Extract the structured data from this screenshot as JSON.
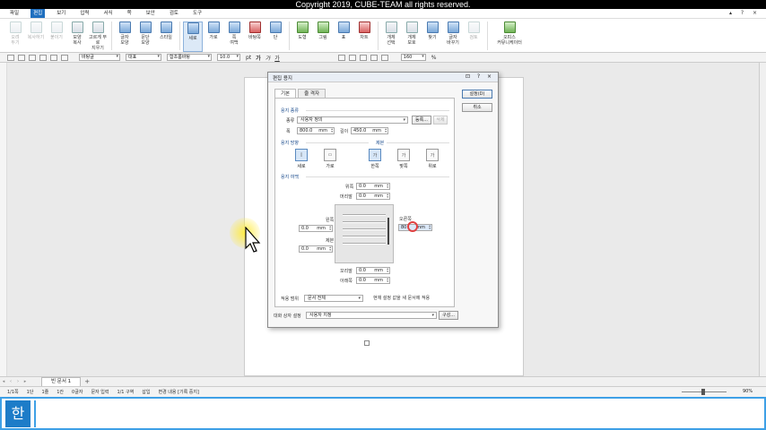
{
  "banner": {
    "text": "Copyright 2019, CUBE-TEAM all rights reserved."
  },
  "menubar": {
    "items": [
      "파일",
      "편집",
      "보기",
      "입력",
      "서식",
      "쪽",
      "보안",
      "검토",
      "도구"
    ],
    "active_index": 1
  },
  "ribbon": {
    "buttons": [
      {
        "label": "오려\n두기",
        "icon": "cut-icon",
        "dim": true
      },
      {
        "label": "복사하기",
        "icon": "copy-icon",
        "dim": true
      },
      {
        "label": "붙이기",
        "icon": "paste-icon",
        "dim": true
      },
      {
        "label": "모양\n복사",
        "icon": "format-painter-icon"
      },
      {
        "label": "고르게 부로\n지우기",
        "icon": "eraser-icon"
      },
      {
        "label": "글자\n모양",
        "icon": "char-shape-icon"
      },
      {
        "label": "문단\n모양",
        "icon": "para-shape-icon"
      },
      {
        "label": "스타일",
        "icon": "style-icon"
      },
      {
        "label": "세로",
        "icon": "portrait-icon",
        "selected": true
      },
      {
        "label": "가로",
        "icon": "landscape-icon"
      },
      {
        "label": "쪽\n여백",
        "icon": "margin-icon"
      },
      {
        "label": "바탕쪽",
        "icon": "master-page-icon"
      },
      {
        "label": "단",
        "icon": "columns-icon"
      },
      {
        "label": "도형",
        "icon": "shape-icon"
      },
      {
        "label": "그림",
        "icon": "picture-icon"
      },
      {
        "label": "표",
        "icon": "table-icon"
      },
      {
        "label": "차트",
        "icon": "chart-icon"
      },
      {
        "label": "개체\n선택",
        "icon": "select-object-icon"
      },
      {
        "label": "개체\n보호",
        "icon": "protect-object-icon"
      },
      {
        "label": "찾기",
        "icon": "find-icon"
      },
      {
        "label": "글자\n바꾸기",
        "icon": "replace-icon"
      },
      {
        "label": "검토",
        "icon": "review-icon",
        "dim": true
      },
      {
        "label": "오피스\n커뮤니케이터",
        "icon": "communicator-icon",
        "wide": true
      }
    ]
  },
  "formatbar": {
    "style_value": "바탕글",
    "lang_value": "대표",
    "font_value": "함초롬바탕",
    "size_value": "10.0",
    "size_unit": "pt",
    "bold": "가",
    "italic": "가",
    "underline": "가",
    "zoom_value": "160",
    "zoom_unit": "%"
  },
  "tabs": {
    "doc_tab": "빈 문서 1",
    "add_tab": "+"
  },
  "statusbar": {
    "items": [
      "1/1쪽",
      "1단",
      "1줄",
      "1칸",
      "0글자",
      "문자 입력",
      "1/1 구역",
      "삽입",
      "변경 내용 [기록 중지]"
    ],
    "zoom": "90%"
  },
  "lowerpanel": {
    "logo_text": "한"
  },
  "dialog": {
    "title": "편집 용지",
    "controls": "⊡ ? ×",
    "tabs": [
      "기본",
      "줄 격자"
    ],
    "ok_button": "설정(D)",
    "cancel_button": "취소",
    "paper_kind": {
      "title": "용지 종류",
      "kind_label": "종류",
      "kind_value": "사용자 정의",
      "register_button": "등록...",
      "delete_button": "삭제",
      "width_label": "폭",
      "width_value": "800.0",
      "length_label": "길이",
      "length_value": "450.0",
      "unit": "mm"
    },
    "orientation": {
      "title": "용지 방향",
      "portrait": "세로",
      "landscape": "가로",
      "portrait_glyph": "▯",
      "landscape_glyph": "▭"
    },
    "binding": {
      "title": "제본",
      "single": "한쪽",
      "facing": "맞쪽",
      "top": "위로",
      "glyph": "가"
    },
    "margins": {
      "title": "용지 여백",
      "top_label": "위쪽",
      "top_value": "0.0",
      "header_label": "머리말",
      "header_value": "0.0",
      "left_label": "왼쪽",
      "left_value": "0.0",
      "gutter_label": "제본",
      "gutter_value": "0.0",
      "right_label": "오른쪽",
      "right_value": "80",
      "footer_label": "꼬리말",
      "footer_value": "0.0",
      "bottom_label": "아래쪽",
      "bottom_value": "0.0",
      "unit": "mm"
    },
    "apply_label": "적용 범위",
    "apply_value": "문서 전체",
    "checkbox_label": "현재 설정 값을 새 문서에 적용",
    "dialog_setting_label": "대화 상자 설정",
    "dialog_setting_value": "사용자 지정",
    "configure_button": "구성..."
  }
}
